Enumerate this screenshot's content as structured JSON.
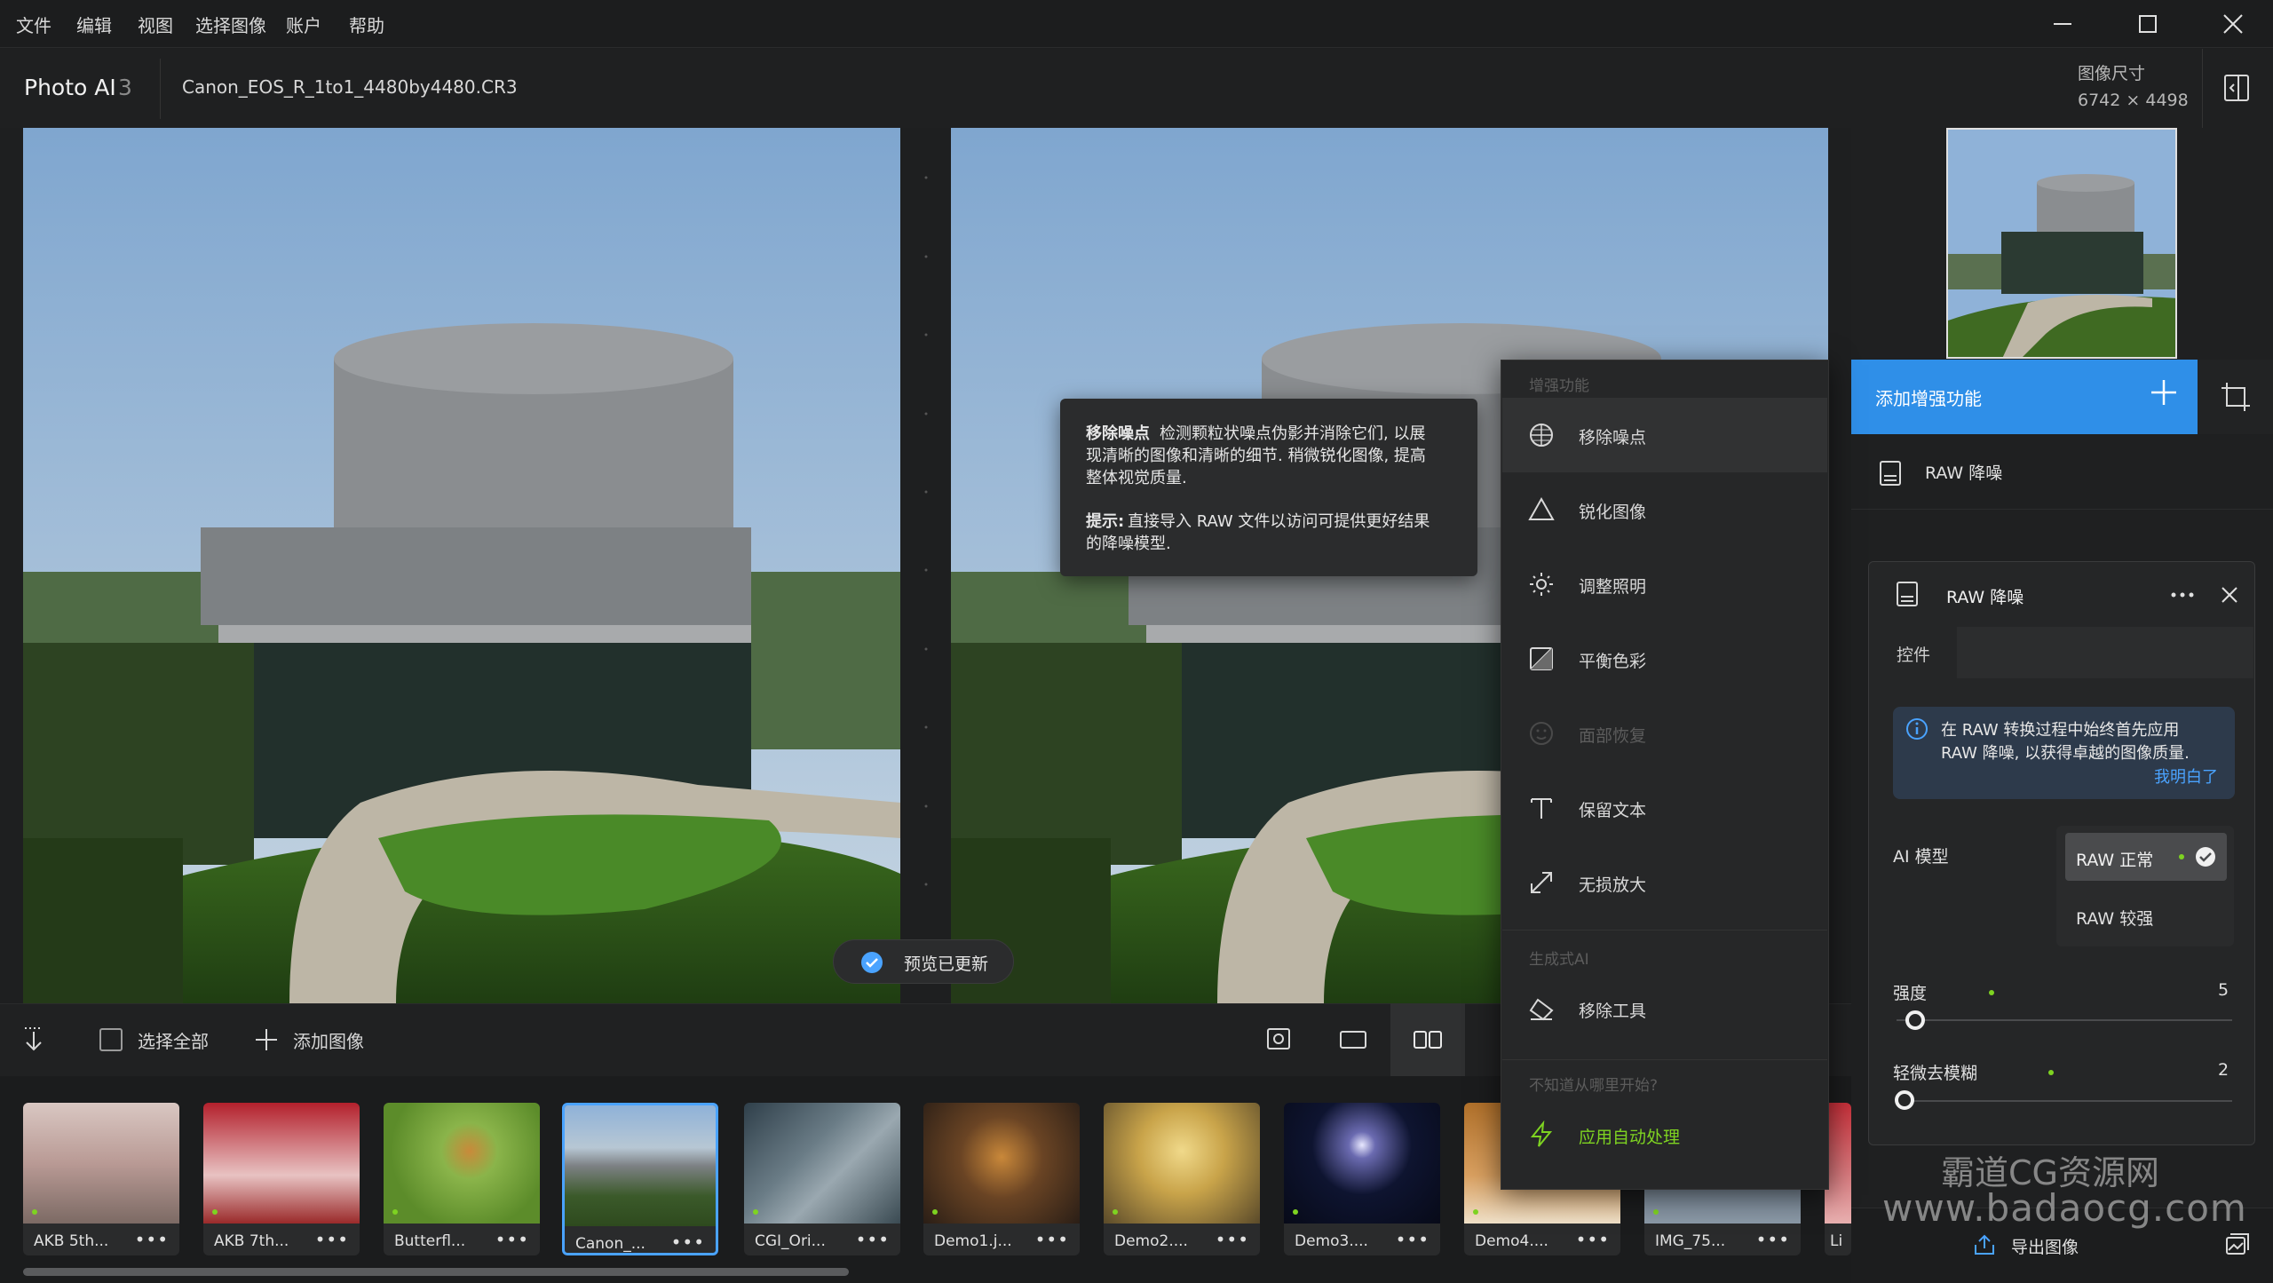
{
  "menubar": {
    "items": [
      "文件",
      "编辑",
      "视图",
      "选择图像",
      "账户",
      "帮助"
    ]
  },
  "header": {
    "app_name": "Photo AI",
    "app_version": "3",
    "file_name": "Canon_EOS_R_1to1_4480by4480.CR3",
    "image_size_label": "图像尺寸",
    "image_size_value": "6742 × 4498"
  },
  "toolbar": {
    "select_all": "选择全部",
    "add_image": "添加图像"
  },
  "filmstrip": {
    "items": [
      {
        "caption": "AKB 5th..."
      },
      {
        "caption": "AKB 7th..."
      },
      {
        "caption": "Butterfl..."
      },
      {
        "caption": "Canon_..."
      },
      {
        "caption": "CGI_Ori..."
      },
      {
        "caption": "Demo1.j..."
      },
      {
        "caption": "Demo2...."
      },
      {
        "caption": "Demo3...."
      },
      {
        "caption": "Demo4...."
      },
      {
        "caption": "IMG_75..."
      },
      {
        "caption": "Li"
      }
    ],
    "more_label": "•••"
  },
  "toast": {
    "text": "预览已更新"
  },
  "tooltip": {
    "title": "移除噪点",
    "line1": "检测颗粒状噪点伪影并消除它们, 以展",
    "line2": "现清晰的图像和清晰的细节. 稍微锐化图像, 提高",
    "line3": "整体视觉质量.",
    "tip_prefix": "提示:",
    "line4": "直接导入 RAW 文件以访问可提供更好结果",
    "line5": "的降噪模型."
  },
  "dropdown": {
    "section_enhance": "增强功能",
    "items": [
      {
        "label": "移除噪点",
        "icon": "noise-icon"
      },
      {
        "label": "锐化图像",
        "icon": "sharpen-icon"
      },
      {
        "label": "调整照明",
        "icon": "light-icon"
      },
      {
        "label": "平衡色彩",
        "icon": "color-icon"
      },
      {
        "label": "面部恢复",
        "icon": "face-icon"
      },
      {
        "label": "保留文本",
        "icon": "text-icon"
      },
      {
        "label": "无损放大",
        "icon": "upscale-icon"
      }
    ],
    "section_gen": "生成式AI",
    "remove_tool": "移除工具",
    "section_help": "不知道从哪里开始?",
    "autopilot": "应用自动处理"
  },
  "right_panel": {
    "add_enhancement": "添加增强功能",
    "raw_row_label": "RAW 降噪",
    "card": {
      "title": "RAW 降噪",
      "tab": "控件",
      "info_line1": "在 RAW 转换过程中始终首先应用",
      "info_line2": "RAW 降噪, 以获得卓越的图像质量.",
      "info_link": "我明白了",
      "ai_model_label": "AI 模型",
      "model_options": [
        "RAW 正常",
        "RAW 较强"
      ],
      "strength_label": "强度",
      "strength_value": "5",
      "deblur_label": "轻微去模糊",
      "deblur_value": "2"
    },
    "export_label": "导出图像"
  },
  "watermark": {
    "line1": "霸道CG资源网",
    "line2": "www.badaocg.com"
  },
  "colors": {
    "accent": "#2f8fe8",
    "status_green": "#7ed321",
    "link": "#4aa3ff"
  }
}
